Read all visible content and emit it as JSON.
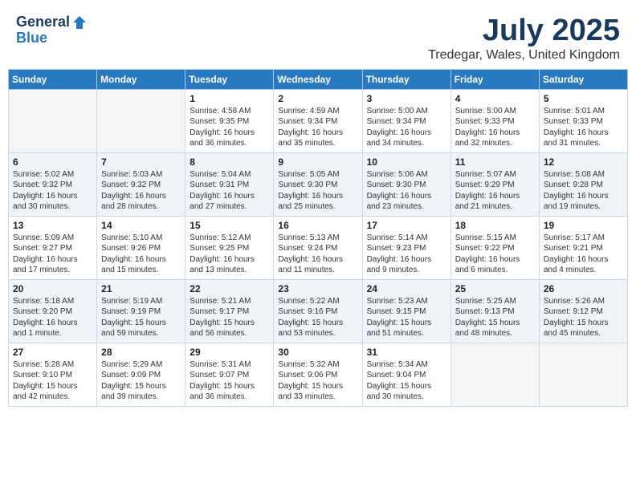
{
  "header": {
    "logo_general": "General",
    "logo_blue": "Blue",
    "title": "July 2025",
    "subtitle": "Tredegar, Wales, United Kingdom"
  },
  "days_header": [
    "Sunday",
    "Monday",
    "Tuesday",
    "Wednesday",
    "Thursday",
    "Friday",
    "Saturday"
  ],
  "weeks": [
    [
      {
        "day": "",
        "info": ""
      },
      {
        "day": "",
        "info": ""
      },
      {
        "day": "1",
        "info": "Sunrise: 4:58 AM\nSunset: 9:35 PM\nDaylight: 16 hours\nand 36 minutes."
      },
      {
        "day": "2",
        "info": "Sunrise: 4:59 AM\nSunset: 9:34 PM\nDaylight: 16 hours\nand 35 minutes."
      },
      {
        "day": "3",
        "info": "Sunrise: 5:00 AM\nSunset: 9:34 PM\nDaylight: 16 hours\nand 34 minutes."
      },
      {
        "day": "4",
        "info": "Sunrise: 5:00 AM\nSunset: 9:33 PM\nDaylight: 16 hours\nand 32 minutes."
      },
      {
        "day": "5",
        "info": "Sunrise: 5:01 AM\nSunset: 9:33 PM\nDaylight: 16 hours\nand 31 minutes."
      }
    ],
    [
      {
        "day": "6",
        "info": "Sunrise: 5:02 AM\nSunset: 9:32 PM\nDaylight: 16 hours\nand 30 minutes."
      },
      {
        "day": "7",
        "info": "Sunrise: 5:03 AM\nSunset: 9:32 PM\nDaylight: 16 hours\nand 28 minutes."
      },
      {
        "day": "8",
        "info": "Sunrise: 5:04 AM\nSunset: 9:31 PM\nDaylight: 16 hours\nand 27 minutes."
      },
      {
        "day": "9",
        "info": "Sunrise: 5:05 AM\nSunset: 9:30 PM\nDaylight: 16 hours\nand 25 minutes."
      },
      {
        "day": "10",
        "info": "Sunrise: 5:06 AM\nSunset: 9:30 PM\nDaylight: 16 hours\nand 23 minutes."
      },
      {
        "day": "11",
        "info": "Sunrise: 5:07 AM\nSunset: 9:29 PM\nDaylight: 16 hours\nand 21 minutes."
      },
      {
        "day": "12",
        "info": "Sunrise: 5:08 AM\nSunset: 9:28 PM\nDaylight: 16 hours\nand 19 minutes."
      }
    ],
    [
      {
        "day": "13",
        "info": "Sunrise: 5:09 AM\nSunset: 9:27 PM\nDaylight: 16 hours\nand 17 minutes."
      },
      {
        "day": "14",
        "info": "Sunrise: 5:10 AM\nSunset: 9:26 PM\nDaylight: 16 hours\nand 15 minutes."
      },
      {
        "day": "15",
        "info": "Sunrise: 5:12 AM\nSunset: 9:25 PM\nDaylight: 16 hours\nand 13 minutes."
      },
      {
        "day": "16",
        "info": "Sunrise: 5:13 AM\nSunset: 9:24 PM\nDaylight: 16 hours\nand 11 minutes."
      },
      {
        "day": "17",
        "info": "Sunrise: 5:14 AM\nSunset: 9:23 PM\nDaylight: 16 hours\nand 9 minutes."
      },
      {
        "day": "18",
        "info": "Sunrise: 5:15 AM\nSunset: 9:22 PM\nDaylight: 16 hours\nand 6 minutes."
      },
      {
        "day": "19",
        "info": "Sunrise: 5:17 AM\nSunset: 9:21 PM\nDaylight: 16 hours\nand 4 minutes."
      }
    ],
    [
      {
        "day": "20",
        "info": "Sunrise: 5:18 AM\nSunset: 9:20 PM\nDaylight: 16 hours\nand 1 minute."
      },
      {
        "day": "21",
        "info": "Sunrise: 5:19 AM\nSunset: 9:19 PM\nDaylight: 15 hours\nand 59 minutes."
      },
      {
        "day": "22",
        "info": "Sunrise: 5:21 AM\nSunset: 9:17 PM\nDaylight: 15 hours\nand 56 minutes."
      },
      {
        "day": "23",
        "info": "Sunrise: 5:22 AM\nSunset: 9:16 PM\nDaylight: 15 hours\nand 53 minutes."
      },
      {
        "day": "24",
        "info": "Sunrise: 5:23 AM\nSunset: 9:15 PM\nDaylight: 15 hours\nand 51 minutes."
      },
      {
        "day": "25",
        "info": "Sunrise: 5:25 AM\nSunset: 9:13 PM\nDaylight: 15 hours\nand 48 minutes."
      },
      {
        "day": "26",
        "info": "Sunrise: 5:26 AM\nSunset: 9:12 PM\nDaylight: 15 hours\nand 45 minutes."
      }
    ],
    [
      {
        "day": "27",
        "info": "Sunrise: 5:28 AM\nSunset: 9:10 PM\nDaylight: 15 hours\nand 42 minutes."
      },
      {
        "day": "28",
        "info": "Sunrise: 5:29 AM\nSunset: 9:09 PM\nDaylight: 15 hours\nand 39 minutes."
      },
      {
        "day": "29",
        "info": "Sunrise: 5:31 AM\nSunset: 9:07 PM\nDaylight: 15 hours\nand 36 minutes."
      },
      {
        "day": "30",
        "info": "Sunrise: 5:32 AM\nSunset: 9:06 PM\nDaylight: 15 hours\nand 33 minutes."
      },
      {
        "day": "31",
        "info": "Sunrise: 5:34 AM\nSunset: 9:04 PM\nDaylight: 15 hours\nand 30 minutes."
      },
      {
        "day": "",
        "info": ""
      },
      {
        "day": "",
        "info": ""
      }
    ]
  ]
}
